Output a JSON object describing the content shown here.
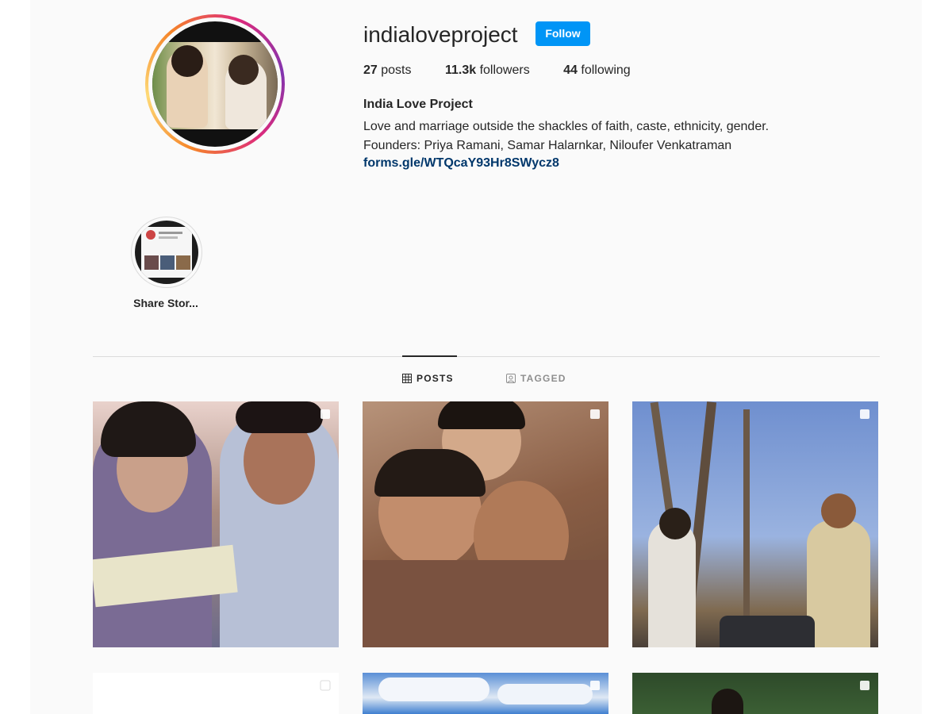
{
  "profile": {
    "username": "indialoveproject",
    "follow_label": "Follow",
    "stats": {
      "posts_count": "27",
      "posts_label": "posts",
      "followers_count": "11.3k",
      "followers_label": "followers",
      "following_count": "44",
      "following_label": "following"
    },
    "full_name": "India Love Project",
    "bio_line1": "Love and marriage outside the shackles of faith, caste, ethnicity, gender.",
    "bio_line2": "Founders: Priya Ramani, Samar Halarnkar, Niloufer Venkatraman",
    "link": "forms.gle/WTQcaY93Hr8SWycz8"
  },
  "highlights": [
    {
      "label": "Share Stor..."
    }
  ],
  "tabs": [
    {
      "label": "POSTS",
      "active": true,
      "icon": "grid-icon"
    },
    {
      "label": "TAGGED",
      "active": false,
      "icon": "tagged-icon"
    }
  ],
  "grid": {
    "tile_count_visible": 6,
    "multi_photo_icon": "carousel-icon"
  },
  "colors": {
    "accent": "#0095f6",
    "link": "#00376b",
    "text": "#262626",
    "muted": "#8e8e8e",
    "background": "#fafafa"
  }
}
